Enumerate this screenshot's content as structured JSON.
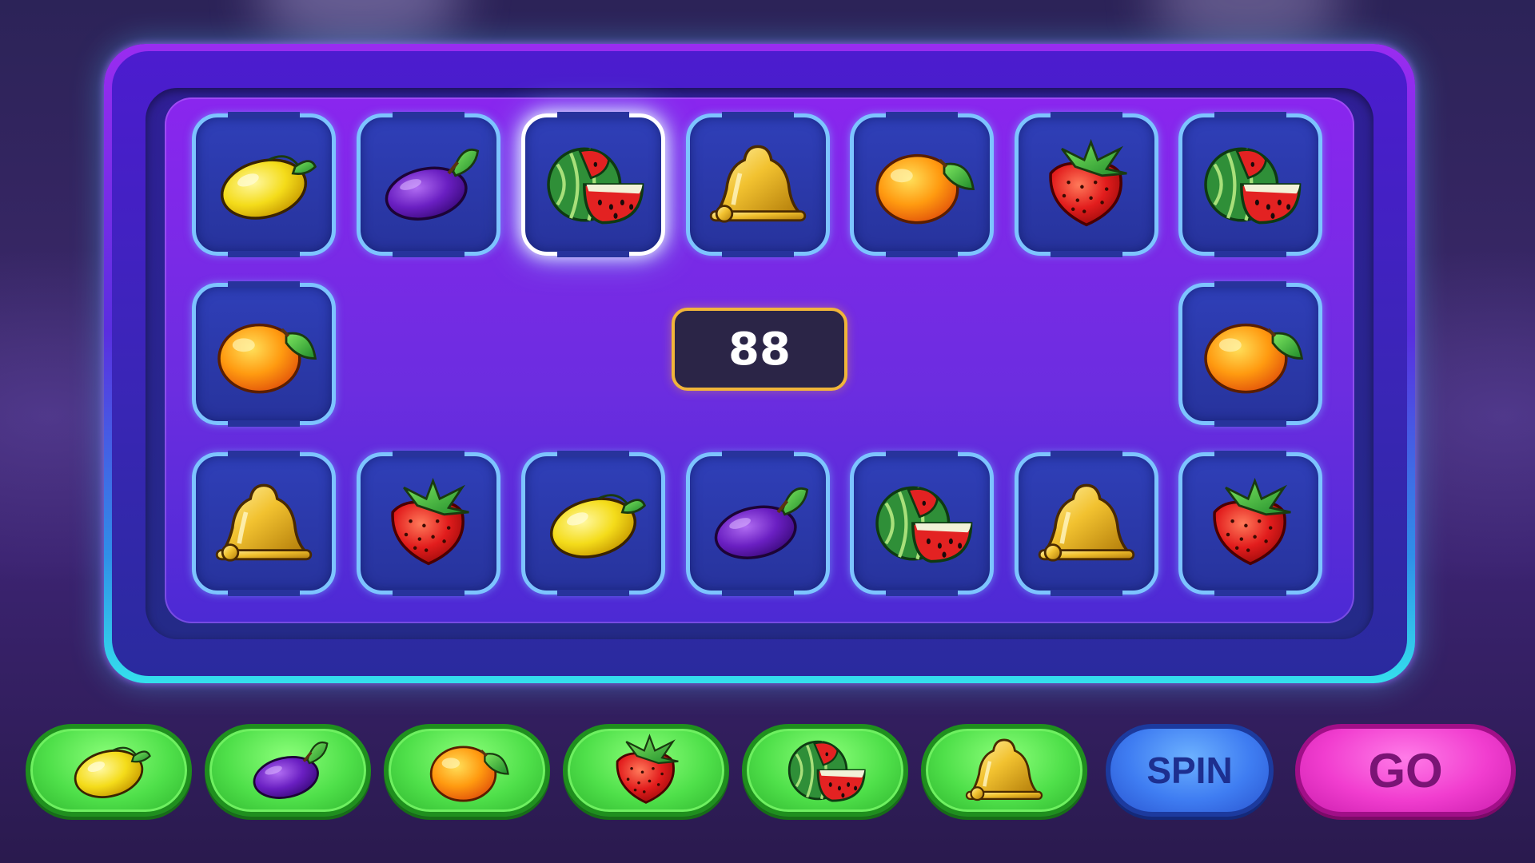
{
  "board": {
    "counter": "88",
    "top_row": [
      "lemon-icon",
      "plum-icon",
      "watermelon-icon",
      "bell-icon",
      "orange-icon",
      "strawberry-icon",
      "watermelon-icon"
    ],
    "middle_left": "orange-icon",
    "middle_right": "orange-icon",
    "bottom_row": [
      "bell-icon",
      "strawberry-icon",
      "lemon-icon",
      "plum-icon",
      "watermelon-icon",
      "bell-icon",
      "strawberry-icon"
    ],
    "highlighted_slot": "top-3"
  },
  "controls": {
    "symbol_buttons": [
      "lemon-icon",
      "plum-icon",
      "orange-icon",
      "strawberry-icon",
      "watermelon-icon",
      "bell-icon"
    ],
    "spin_label": "SPIN",
    "go_label": "GO"
  },
  "colors": {
    "frame": "#9a2cf0",
    "board": "#8a26ee",
    "slot_border": "#7dc4ff",
    "counter_border": "#f1b53a",
    "symbol_button": "#4fe04a",
    "spin_button": "#3f7df2",
    "go_button": "#f13dcf"
  }
}
